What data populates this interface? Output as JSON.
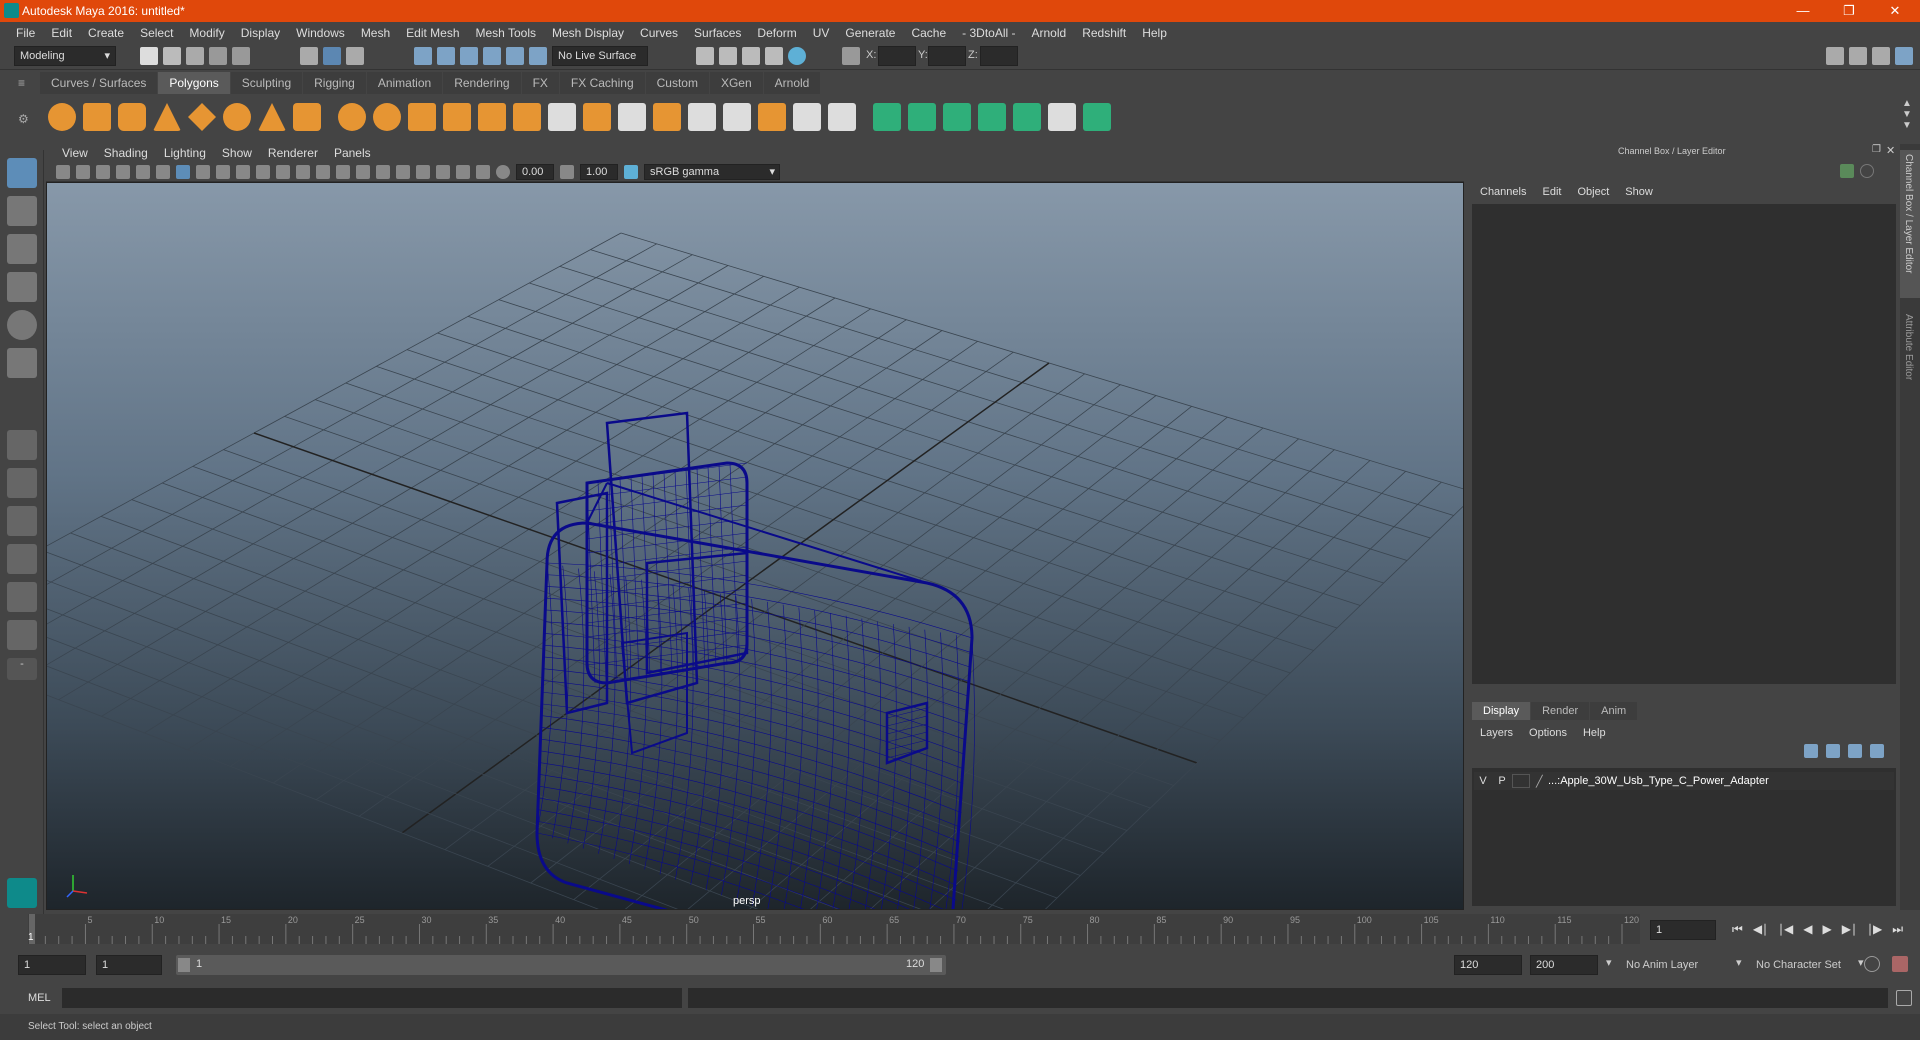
{
  "window": {
    "title": "Autodesk Maya 2016: untitled*"
  },
  "menus": [
    "File",
    "Edit",
    "Create",
    "Select",
    "Modify",
    "Display",
    "Windows",
    "Mesh",
    "Edit Mesh",
    "Mesh Tools",
    "Mesh Display",
    "Curves",
    "Surfaces",
    "Deform",
    "UV",
    "Generate",
    "Cache",
    "- 3DtoAll -",
    "Arnold",
    "Redshift",
    "Help"
  ],
  "status": {
    "mode": "Modeling",
    "live_surface": "No Live Surface",
    "x_label": "X:",
    "y_label": "Y:",
    "z_label": "Z:"
  },
  "shelf_tabs": [
    "Curves / Surfaces",
    "Polygons",
    "Sculpting",
    "Rigging",
    "Animation",
    "Rendering",
    "FX",
    "FX Caching",
    "Custom",
    "XGen",
    "Arnold"
  ],
  "active_shelf": "Polygons",
  "viewport": {
    "menus": [
      "View",
      "Shading",
      "Lighting",
      "Show",
      "Renderer",
      "Panels"
    ],
    "exposure": "0.00",
    "gamma": "1.00",
    "colorspace": "sRGB gamma",
    "camera_label": "persp"
  },
  "channel_box": {
    "header": "Channel Box / Layer Editor",
    "menus": [
      "Channels",
      "Edit",
      "Object",
      "Show"
    ]
  },
  "layer_editor": {
    "tabs": [
      "Display",
      "Render",
      "Anim"
    ],
    "menus": [
      "Layers",
      "Options",
      "Help"
    ],
    "layer": {
      "v": "V",
      "p": "P",
      "name": "...:Apple_30W_Usb_Type_C_Power_Adapter"
    }
  },
  "side_tabs": [
    "Channel Box / Layer Editor",
    "Attribute Editor"
  ],
  "timeline": {
    "ticks": [
      "5",
      "10",
      "15",
      "20",
      "25",
      "30",
      "35",
      "40",
      "45",
      "50",
      "55",
      "60",
      "65",
      "70",
      "75",
      "80",
      "85",
      "90",
      "95",
      "100",
      "105",
      "110",
      "115",
      "120"
    ],
    "start_marker": "1",
    "current_frame": "1"
  },
  "range": {
    "start": "1",
    "inner_start": "1",
    "slider_start": "1",
    "slider_end": "120",
    "end": "120",
    "outer_end": "200",
    "anim_layer": "No Anim Layer",
    "char_set": "No Character Set"
  },
  "cmd": {
    "label": "MEL"
  },
  "help_line": "Select Tool: select an object",
  "colors": {
    "title_bar": "#e0480b",
    "wire": "#0a0a8a",
    "active_tab": "#5a5a5a",
    "accent": "#e69533"
  }
}
